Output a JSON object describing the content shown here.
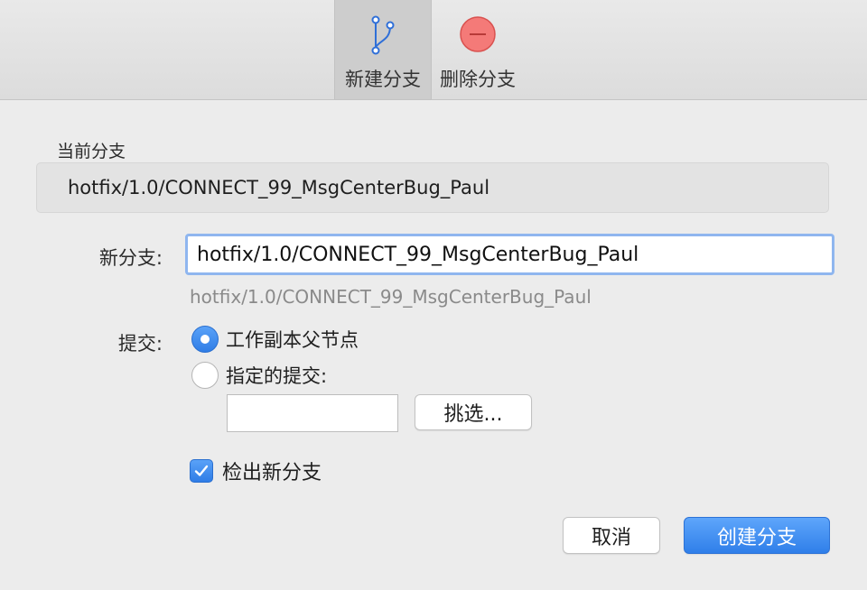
{
  "toolbar": {
    "new_branch_label": "新建分支",
    "new_branch_icon": "branch-icon",
    "delete_branch_label": "删除分支",
    "delete_branch_icon": "minus-circle-icon"
  },
  "current_branch": {
    "title": "当前分支",
    "value": "hotfix/1.0/CONNECT_99_MsgCenterBug_Paul"
  },
  "new_branch": {
    "label": "新分支:",
    "value": "hotfix/1.0/CONNECT_99_MsgCenterBug_Paul",
    "hint": "hotfix/1.0/CONNECT_99_MsgCenterBug_Paul"
  },
  "commit": {
    "label": "提交:",
    "option_working_copy": "工作副本父节点",
    "option_specified": "指定的提交:",
    "selected": "working_copy",
    "commit_value": "",
    "pick_button": "挑选..."
  },
  "checkout": {
    "label": "检出新分支",
    "checked": true
  },
  "buttons": {
    "cancel": "取消",
    "create": "创建分支"
  },
  "colors": {
    "accent": "#3b87f0",
    "delete_red": "#f16b6b"
  }
}
